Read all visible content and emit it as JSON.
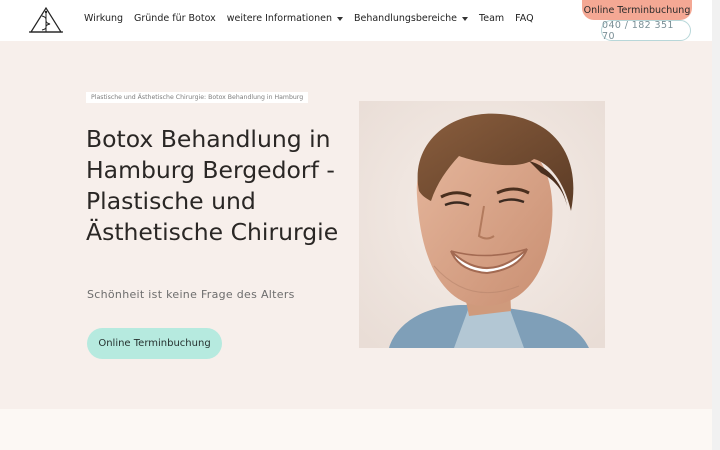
{
  "header": {
    "logo_icon": "caduceus-logo-icon",
    "nav": [
      {
        "label": "Wirkung",
        "dropdown": false
      },
      {
        "label": "Gründe für Botox",
        "dropdown": false
      },
      {
        "label": "weitere Informationen",
        "dropdown": true
      },
      {
        "label": "Behandlungsbereiche",
        "dropdown": true
      },
      {
        "label": "Team",
        "dropdown": false
      },
      {
        "label": "FAQ",
        "dropdown": false
      }
    ],
    "book_label": "Online Terminbuchung",
    "phone": "040 / 182 351 70"
  },
  "hero": {
    "breadcrumb": "Plastische und Ästhetische Chirurgie: Botox Behandlung in Hamburg",
    "title": "Botox Behandlung in Hamburg Bergedorf - Plastische und Ästhetische Chirurgie",
    "subtitle": "Schönheit ist keine Frage des Alters",
    "cta_label": "Online Terminbuchung",
    "image": "smiling-man-portrait"
  },
  "colors": {
    "hero_bg": "#f7efeb",
    "book_top": "#f4a894",
    "cta": "#b6eadf",
    "phone_border": "#b8d7d9"
  }
}
